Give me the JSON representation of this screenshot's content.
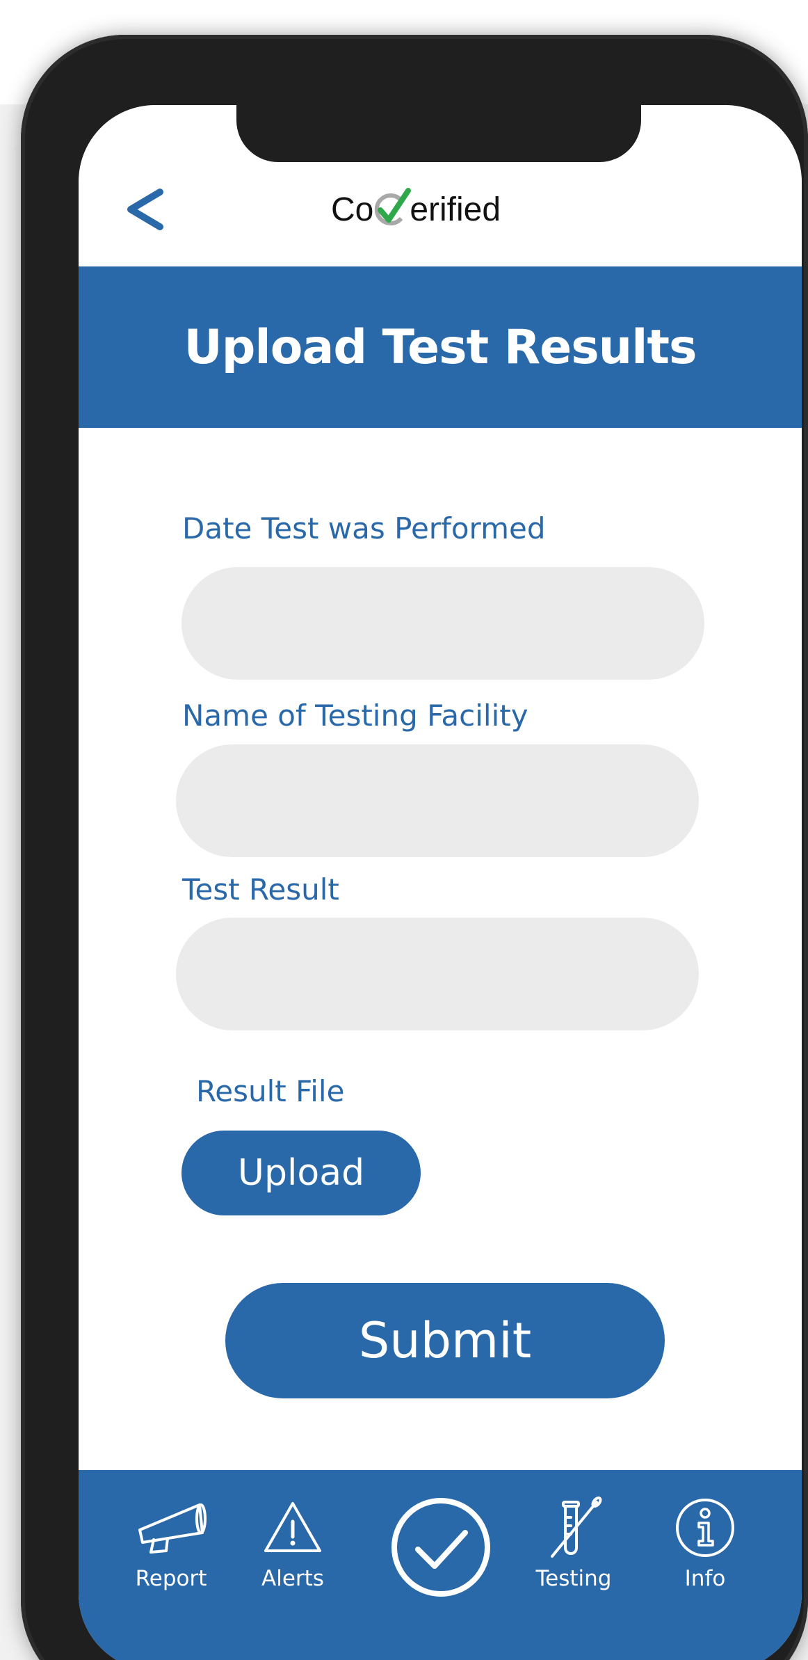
{
  "app": {
    "logo_text_left": "Co",
    "logo_text_right": "erified"
  },
  "header": {
    "title": "Upload Test Results"
  },
  "form": {
    "date_label": "Date Test was Performed",
    "date_value": "",
    "facility_label": "Name of Testing Facility",
    "facility_value": "",
    "result_label": "Test Result",
    "result_value": "",
    "file_label": "Result File",
    "upload_label": "Upload",
    "submit_label": "Submit"
  },
  "tabbar": {
    "items": [
      {
        "label": "Report",
        "icon": "megaphone-icon"
      },
      {
        "label": "Alerts",
        "icon": "warning-triangle-icon"
      },
      {
        "label": "",
        "icon": "check-circle-icon"
      },
      {
        "label": "Testing",
        "icon": "test-tube-icon"
      },
      {
        "label": "Info",
        "icon": "info-circle-icon"
      }
    ]
  },
  "colors": {
    "brand_blue": "#2a69a9",
    "check_green": "#2ea84a",
    "input_gray": "#ebebeb"
  }
}
